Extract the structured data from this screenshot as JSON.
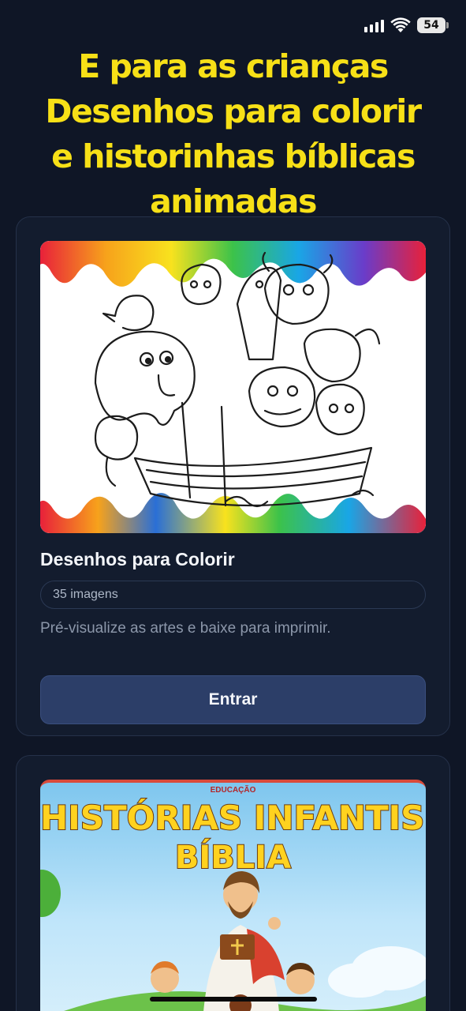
{
  "status": {
    "battery": "54"
  },
  "headline": {
    "lines": [
      "E para as crianças",
      "Desenhos para colorir",
      "e historinhas bíblicas",
      "animadas"
    ]
  },
  "coloring_card": {
    "title": "Desenhos para Colorir",
    "count": "35 imagens",
    "description": "Pré-visualize as artes e baixe para imprimir.",
    "button_label": "Entrar"
  },
  "stories_card": {
    "brand": "EDUCAÇÃO",
    "title_line1": "HISTÓRIAS INFANTIS DA",
    "title_line2": "BÍBLIA"
  },
  "colors": {
    "headline": "#f7e017",
    "background": "#0f1626",
    "card": "#131c2e",
    "button": "#2c3e68"
  }
}
